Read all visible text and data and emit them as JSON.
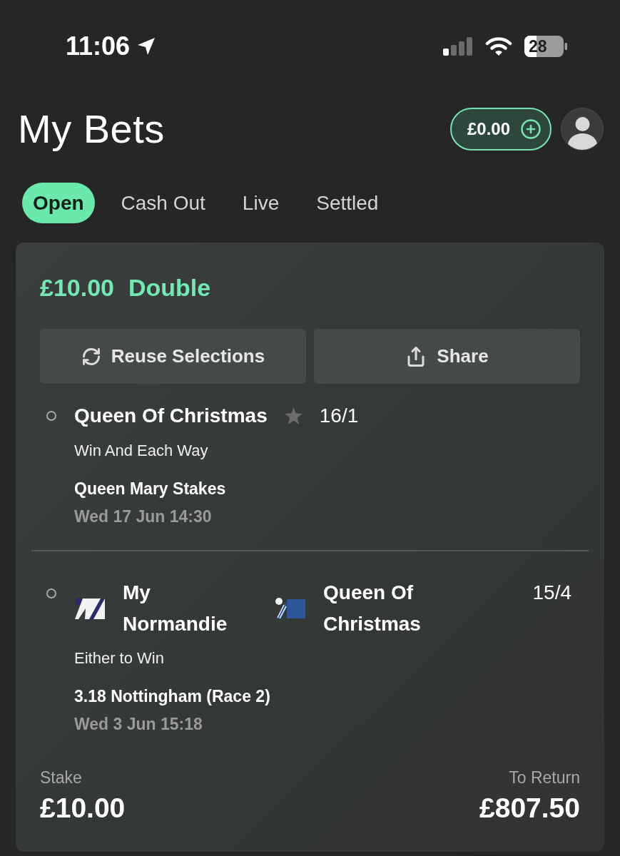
{
  "status_bar": {
    "time": "11:06",
    "battery": "28"
  },
  "header": {
    "title": "My Bets",
    "balance": "£0.00"
  },
  "tabs": [
    {
      "label": "Open",
      "selected": true
    },
    {
      "label": "Cash Out",
      "selected": false
    },
    {
      "label": "Live",
      "selected": false
    },
    {
      "label": "Settled",
      "selected": false
    }
  ],
  "bet": {
    "amount": "£10.00",
    "type": "Double",
    "actions": [
      {
        "label": "Reuse Selections",
        "kind": "reuse"
      },
      {
        "label": "Share",
        "kind": "share"
      }
    ],
    "selections": [
      {
        "kind": "single",
        "name": "Queen Of Christmas",
        "odds": "16/1",
        "market": "Win And Each Way",
        "event": "Queen Mary Stakes",
        "time": "Wed 17 Jun 14:30"
      },
      {
        "kind": "either",
        "runners": [
          {
            "name": "My Normandie",
            "kind": "band",
            "color": "#f2f2f2"
          },
          {
            "name": "Queen Of Christmas",
            "kind": "sleeves",
            "color": "#2d5597"
          }
        ],
        "odds": "15/4",
        "market": "Either to Win",
        "event": "3.18 Nottingham (Race 2)",
        "time": "Wed 3 Jun 15:18"
      }
    ],
    "stake": {
      "label": "Stake",
      "value": "£10.00"
    },
    "to_return": {
      "label": "To Return",
      "value": "£807.50"
    }
  }
}
